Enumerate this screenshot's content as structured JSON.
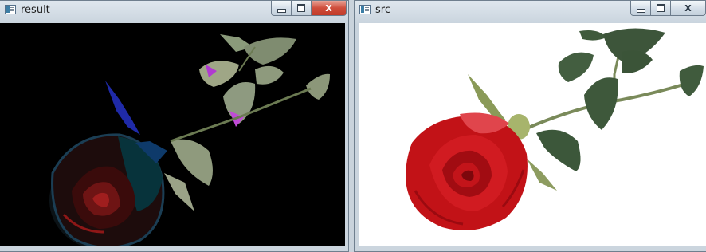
{
  "windows": [
    {
      "title": "result",
      "close_icon": "x-icon",
      "content": "image"
    },
    {
      "title": "src",
      "close_icon": "x-icon",
      "content": "image"
    }
  ],
  "caption": {
    "close_label": "X"
  }
}
